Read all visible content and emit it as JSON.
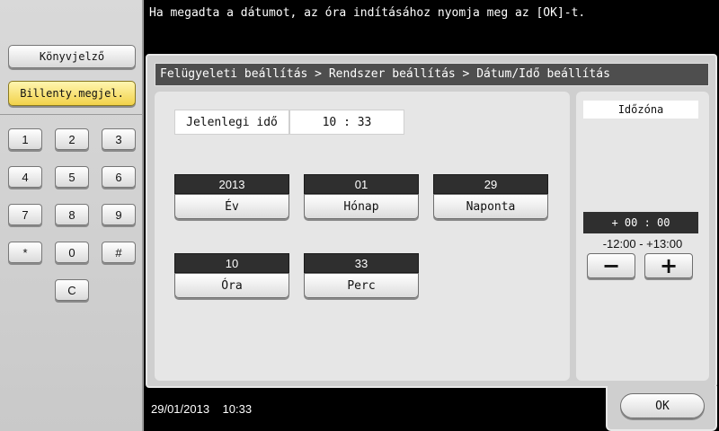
{
  "message": "Ha megadta a dátumot, az óra indításához nyomja meg az  [OK]-t.",
  "left_panel": {
    "bookmark_label": "Könyvjelző",
    "keyboard_label": "Billenty.megjel.",
    "keypad": [
      "1",
      "2",
      "3",
      "4",
      "5",
      "6",
      "7",
      "8",
      "9",
      "*",
      "0",
      "#",
      "C"
    ]
  },
  "breadcrumb": "Felügyeleti beállítás > Rendszer beállítás > Dátum/Idő beállítás",
  "current_time": {
    "label": "Jelenlegi idő",
    "value": "10 : 33"
  },
  "fields": {
    "year": {
      "value": "2013",
      "label": "Év"
    },
    "month": {
      "value": "01",
      "label": "Hónap"
    },
    "day": {
      "value": "29",
      "label": "Naponta"
    },
    "hour": {
      "value": "10",
      "label": "Óra"
    },
    "minute": {
      "value": "33",
      "label": "Perc"
    }
  },
  "timezone": {
    "title": "Időzóna",
    "value": "+ 00 : 00",
    "range": "-12:00 - +13:00",
    "minus_label": "−",
    "plus_label": "+"
  },
  "status": {
    "datetime": "29/01/2013    10:33"
  },
  "ok_label": "OK",
  "colors": {
    "background": "#000000",
    "panel": "#cfcfcf",
    "highlight_button": "#f2d24a",
    "value_box": "#2f2f2f"
  }
}
